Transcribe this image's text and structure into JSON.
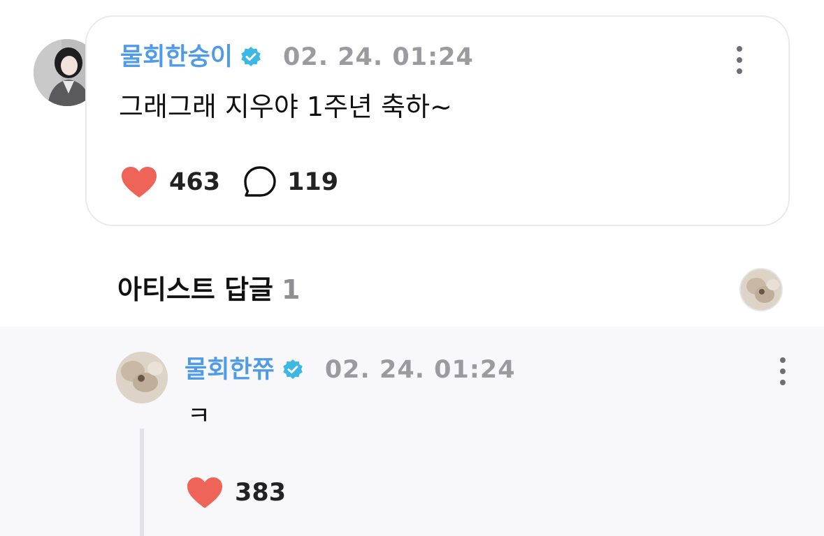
{
  "post": {
    "author": "물회한숭이",
    "timestamp": "02. 24. 01:24",
    "text": "그래그래 지우야 1주년 축하~",
    "likes": "463",
    "comments": "119",
    "avatar_icon": "user-avatar-photo",
    "verified_icon": "verified-badge-icon",
    "more_icon": "more-vertical-icon"
  },
  "artist_replies": {
    "title": "아티스트 답글",
    "count": "1",
    "avatar_icon": "artist-avatar-photo"
  },
  "reply": {
    "author": "물회한쮸",
    "timestamp": "02. 24. 01:24",
    "text": "ㅋ",
    "likes": "383",
    "avatar_icon": "artist-avatar-photo",
    "verified_icon": "verified-badge-icon",
    "more_icon": "more-vertical-icon"
  },
  "colors": {
    "name": "#4f9be6",
    "verified": "#3db7e4",
    "heart": "#ef6459",
    "timestamp": "#9b9b9f",
    "reply_background": "#f8f8fb"
  }
}
